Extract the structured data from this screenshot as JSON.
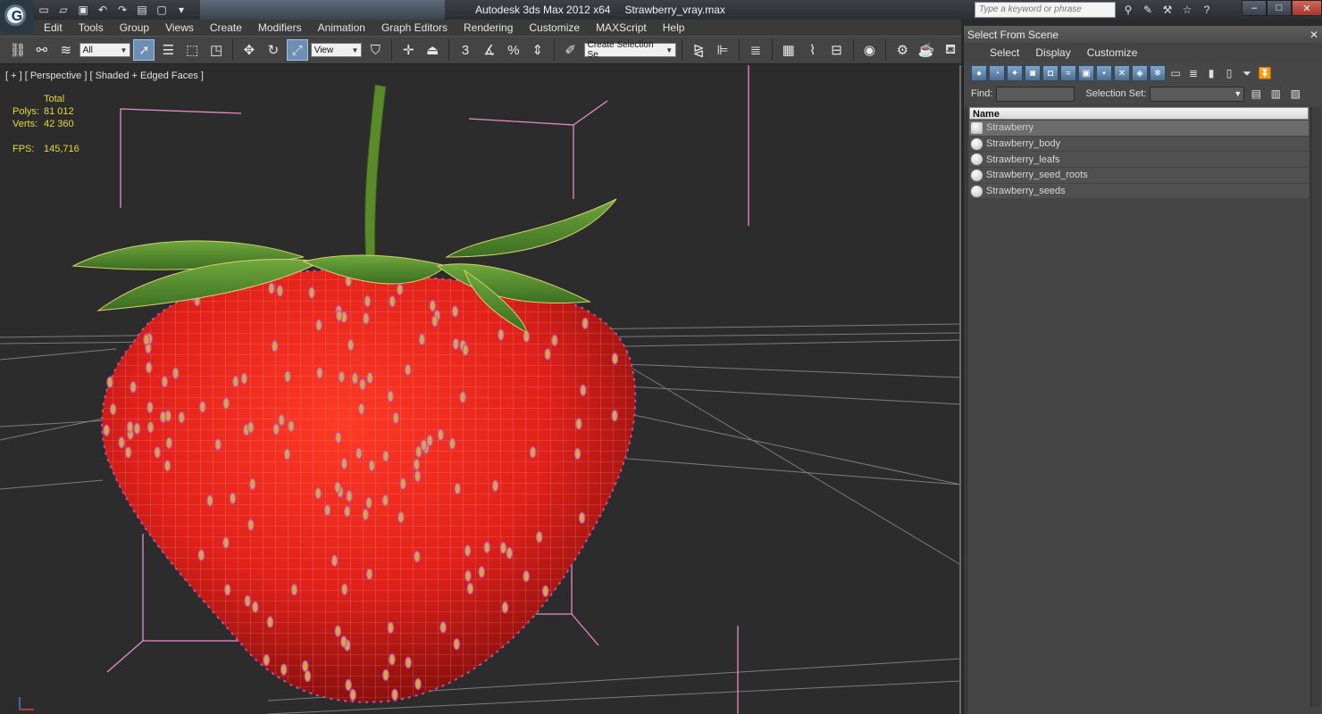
{
  "window": {
    "app_name": "Autodesk 3ds Max  2012 x64",
    "file_name": "Strawberry_vray.max",
    "logo_text": "G",
    "search_placeholder": "Type a keyword or phrase"
  },
  "menu": [
    "Edit",
    "Tools",
    "Group",
    "Views",
    "Create",
    "Modifiers",
    "Animation",
    "Graph Editors",
    "Rendering",
    "Customize",
    "MAXScript",
    "Help"
  ],
  "toolbar": {
    "filter_value": "All",
    "coord_value": "View",
    "selection_set_value": "Create Selection Se"
  },
  "viewport": {
    "label": "[ + ] [ Perspective ] [ Shaded + Edged Faces ]",
    "stats": {
      "header": "Total",
      "polys_label": "Polys:",
      "polys_value": "81 012",
      "verts_label": "Verts:",
      "verts_value": "42 360",
      "fps_label": "FPS:",
      "fps_value": "145,716"
    },
    "colors": {
      "background": "#2c2c2c",
      "grid": "#8a8a8a",
      "bbox": "#e88cc8",
      "strawberry": "#e0201a",
      "leaf": "#4f8a2a",
      "seed": "#d8a640"
    }
  },
  "scene_explorer": {
    "title": "Select From Scene",
    "menu": [
      "Select",
      "Display",
      "Customize"
    ],
    "find_label": "Find:",
    "selection_set_label": "Selection Set:",
    "column_name": "Name",
    "objects": [
      {
        "name": "Strawberry",
        "selected": true,
        "icon": "group-icon"
      },
      {
        "name": "Strawberry_body",
        "selected": false,
        "icon": "object-icon"
      },
      {
        "name": "Strawberry_leafs",
        "selected": false,
        "icon": "object-icon"
      },
      {
        "name": "Strawberry_seed_roots",
        "selected": false,
        "icon": "object-icon"
      },
      {
        "name": "Strawberry_seeds",
        "selected": false,
        "icon": "object-icon"
      }
    ]
  }
}
